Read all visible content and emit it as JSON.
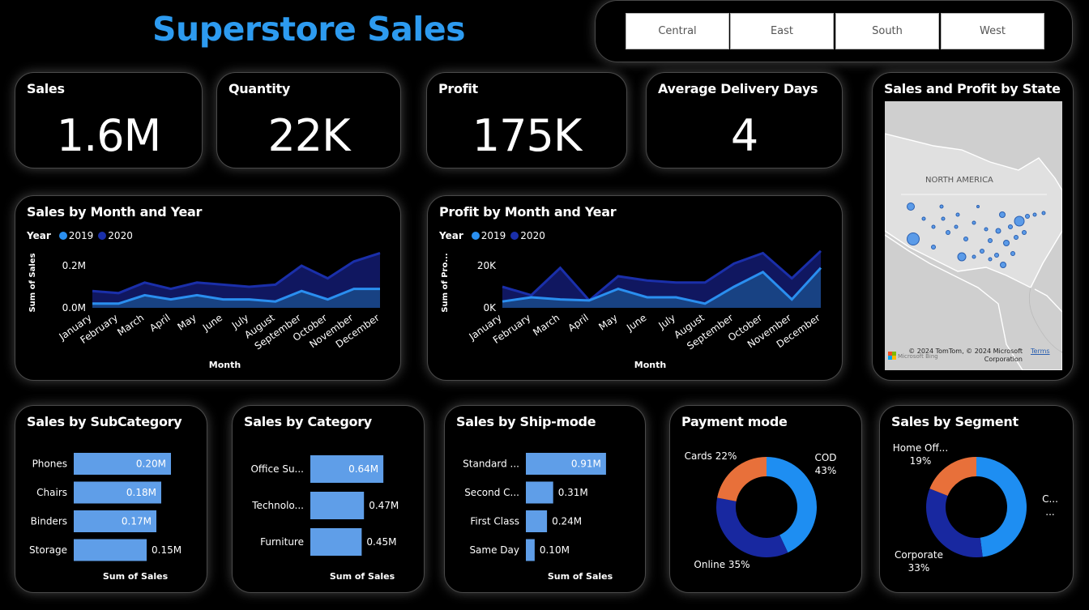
{
  "header": {
    "title": "Superstore Sales"
  },
  "slicer": {
    "regions": [
      "Central",
      "East",
      "South",
      "West"
    ]
  },
  "kpis": [
    {
      "label": "Sales",
      "value": "1.6M"
    },
    {
      "label": "Quantity",
      "value": "22K"
    },
    {
      "label": "Profit",
      "value": "175K"
    },
    {
      "label": "Average Delivery Days",
      "value": "4"
    }
  ],
  "map": {
    "title": "Sales and Profit by State",
    "region_label": "NORTH AMERICA",
    "copyright": "© 2024 TomTom, © 2024 Microsoft Corporation",
    "terms": "Terms",
    "bing": "Microsoft Bing"
  },
  "colors": {
    "y2019": "#2a8ff0",
    "y2020": "#1a2faa",
    "bar": "#5f9ee8",
    "cod": "#1e8ef2",
    "online": "#1828a0",
    "cards": "#e8703a"
  },
  "chart_data": [
    {
      "type": "area",
      "title": "Sales by Month and Year",
      "legend_title": "Year",
      "xlabel": "Month",
      "ylabel": "Sum of Sales",
      "yticks": [
        "0.2M",
        "0.0M"
      ],
      "ylim": [
        0,
        0.3
      ],
      "categories": [
        "January",
        "February",
        "March",
        "April",
        "May",
        "June",
        "July",
        "August",
        "September",
        "October",
        "November",
        "December"
      ],
      "series": [
        {
          "name": "2019",
          "values": [
            0.02,
            0.02,
            0.06,
            0.04,
            0.06,
            0.04,
            0.04,
            0.03,
            0.08,
            0.04,
            0.09,
            0.09
          ]
        },
        {
          "name": "2020",
          "values": [
            0.08,
            0.07,
            0.12,
            0.09,
            0.12,
            0.11,
            0.1,
            0.11,
            0.2,
            0.14,
            0.22,
            0.26
          ]
        }
      ]
    },
    {
      "type": "area",
      "title": "Profit by Month and Year",
      "legend_title": "Year",
      "xlabel": "Month",
      "ylabel": "Sum of Pro...",
      "yticks": [
        "20K",
        "0K"
      ],
      "ylim": [
        0,
        30000
      ],
      "categories": [
        "January",
        "February",
        "March",
        "April",
        "May",
        "June",
        "July",
        "August",
        "September",
        "October",
        "November",
        "December"
      ],
      "series": [
        {
          "name": "2019",
          "values": [
            3000,
            5000,
            4000,
            3500,
            9000,
            5000,
            5000,
            2000,
            10000,
            17000,
            4000,
            19000
          ]
        },
        {
          "name": "2020",
          "values": [
            10000,
            6000,
            19000,
            3500,
            15000,
            13000,
            12000,
            12000,
            21000,
            26000,
            14000,
            27000
          ]
        }
      ]
    },
    {
      "type": "bar",
      "title": "Sales by SubCategory",
      "xlabel": "Sum of Sales",
      "categories": [
        "Phones",
        "Chairs",
        "Binders",
        "Storage"
      ],
      "values": [
        0.2,
        0.18,
        0.17,
        0.15
      ],
      "labels": [
        "0.20M",
        "0.18M",
        "0.17M",
        "0.15M"
      ],
      "xlim": [
        0,
        0.21
      ]
    },
    {
      "type": "bar",
      "title": "Sales by Category",
      "xlabel": "Sum of Sales",
      "categories": [
        "Office Su...",
        "Technolo...",
        "Furniture"
      ],
      "values": [
        0.64,
        0.47,
        0.45
      ],
      "labels": [
        "0.64M",
        "0.47M",
        "0.45M"
      ],
      "xlim": [
        0,
        0.71
      ]
    },
    {
      "type": "bar",
      "title": "Sales by Ship-mode",
      "xlabel": "Sum of Sales",
      "categories": [
        "Standard ...",
        "Second C...",
        "First Class",
        "Same Day"
      ],
      "values": [
        0.91,
        0.31,
        0.24,
        0.1
      ],
      "labels": [
        "0.91M",
        "0.31M",
        "0.24M",
        "0.10M"
      ],
      "xlim": [
        0,
        0.92
      ]
    },
    {
      "type": "pie",
      "title": "Payment mode",
      "categories": [
        "COD",
        "Online",
        "Cards"
      ],
      "values": [
        43,
        35,
        22
      ],
      "labels": [
        "COD\n43%",
        "Online 35%",
        "Cards 22%"
      ]
    },
    {
      "type": "pie",
      "title": "Sales by Segment",
      "categories": [
        "C...",
        "Corporate",
        "Home Off..."
      ],
      "values": [
        48,
        33,
        19
      ],
      "labels": [
        "C...\n...",
        "Corporate\n33%",
        "Home Off...\n19%"
      ]
    }
  ]
}
